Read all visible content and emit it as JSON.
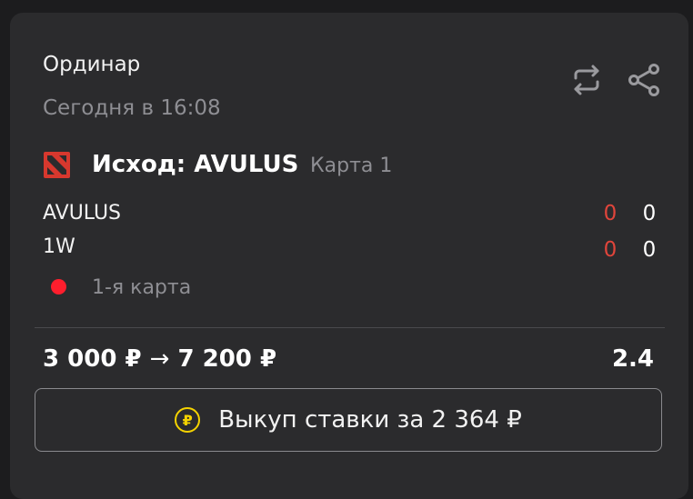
{
  "bet": {
    "type": "Ординар",
    "time": "Сегодня в 16:08"
  },
  "icons": {
    "repeat": "repeat-icon",
    "share": "share-icon",
    "game": "dota2-logo-icon",
    "coin": "ruble-coin-icon",
    "arrow": "→"
  },
  "event": {
    "outcome": "Исход: AVULUS",
    "map": "Карта 1",
    "teams": [
      {
        "name": "AVULUS",
        "score_map": "0",
        "score_total": "0"
      },
      {
        "name": "1W",
        "score_map": "0",
        "score_total": "0"
      }
    ],
    "status": "1-я карта"
  },
  "stake": {
    "amount": "3 000 ₽",
    "arrow": "→",
    "payout": "7 200 ₽",
    "coefficient": "2.4"
  },
  "cashout": {
    "coin_symbol": "₽",
    "label": "Выкуп ставки за 2 364 ₽"
  },
  "colors": {
    "background": "#1c1c1e",
    "card": "#2b2b2d",
    "muted_text": "#8e8e93",
    "score_red": "#e0453b",
    "live_dot": "#ff1e2d",
    "coin": "#f5d300"
  }
}
